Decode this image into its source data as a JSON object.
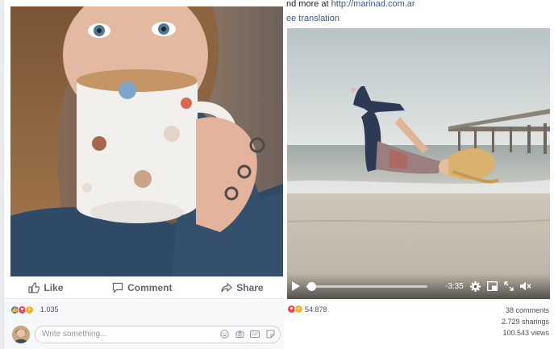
{
  "left_post": {
    "actions": {
      "like_label": "Like",
      "comment_label": "Comment",
      "share_label": "Share"
    },
    "reactions": {
      "count": "1.035",
      "types": [
        "like",
        "love",
        "wow"
      ]
    },
    "comment_box": {
      "placeholder": "Write something..."
    },
    "input_icons": [
      "emoji-icon",
      "camera-icon",
      "gif-icon",
      "sticker-icon"
    ]
  },
  "right_post": {
    "header_text": "nd more at",
    "header_link": "http://marinad.com.ar",
    "see_translation": "ee translation",
    "video": {
      "time_remaining": "-3:35",
      "progress": 0.02
    },
    "reactions": {
      "count": "54.878",
      "types": [
        "love",
        "wow"
      ]
    },
    "stats": {
      "comments": "38 comments",
      "sharings": "2.729 sharings",
      "views": "100.543 views"
    }
  },
  "colors": {
    "facebook_blue": "#365899",
    "like_blue": "#3578e5",
    "love_red": "#f33e58",
    "wow_yellow": "#f7b125",
    "action_gray": "#606770"
  }
}
